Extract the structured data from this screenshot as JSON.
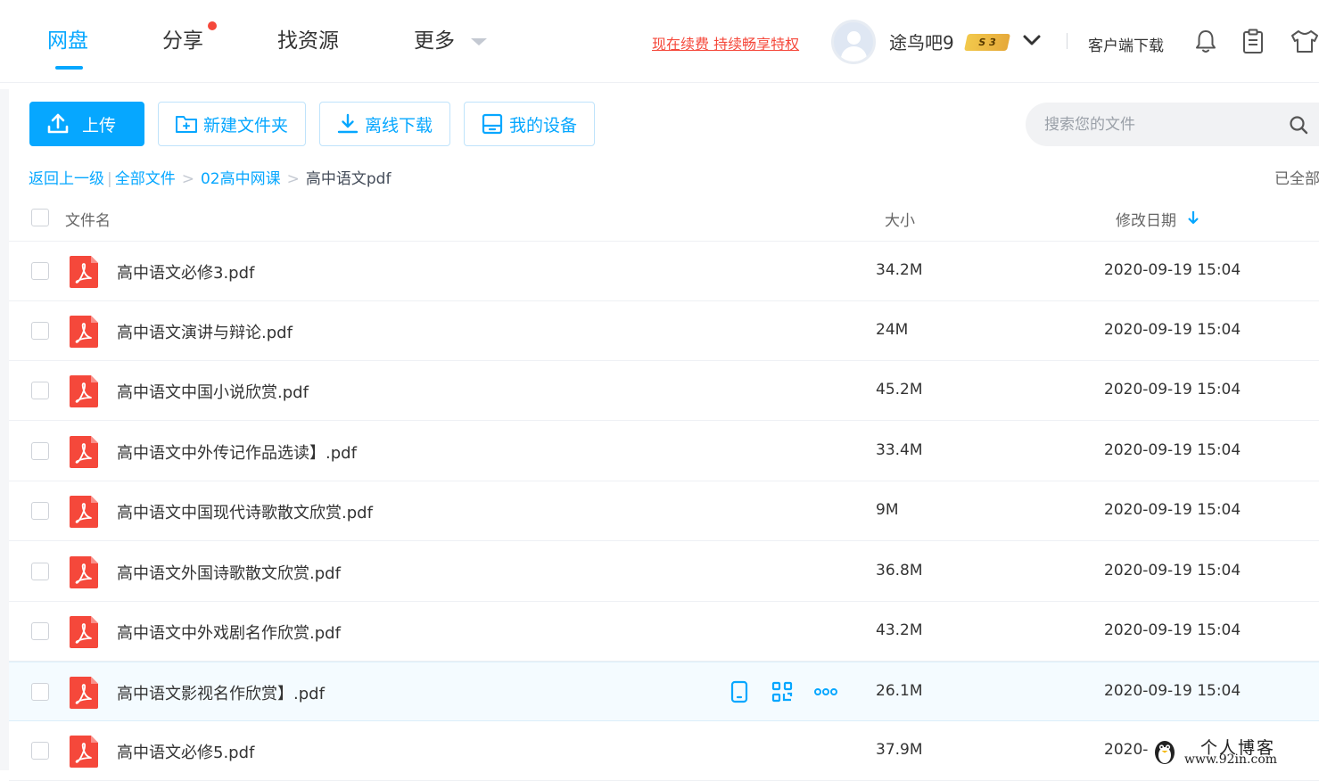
{
  "colors": {
    "accent": "#06a7ff",
    "promo": "#f5483b",
    "pdf": "#f5483b"
  },
  "nav": {
    "tabs": [
      {
        "label": "网盘",
        "active": true
      },
      {
        "label": "分享",
        "active": false
      },
      {
        "label": "找资源",
        "active": false
      },
      {
        "label": "更多",
        "active": false
      }
    ],
    "promo": "现在续费 持续畅享特权",
    "username": "途鸟吧9",
    "vip_badge": "S 3",
    "client_download": "客户端下载",
    "icons": [
      "bell-icon",
      "clipboard-icon",
      "tshirt-icon"
    ]
  },
  "toolbar": {
    "upload": "上传",
    "new_folder": "新建文件夹",
    "offline_download": "离线下载",
    "my_devices": "我的设备",
    "search_placeholder": "搜索您的文件"
  },
  "breadcrumb": {
    "back": "返回上一级",
    "items": [
      "全部文件",
      "02高中网课"
    ],
    "current": "高中语文pdf",
    "loaded_status": "已全部"
  },
  "table": {
    "headers": {
      "name": "文件名",
      "size": "大小",
      "date": "修改日期"
    },
    "rows": [
      {
        "name": "高中语文必修3.pdf",
        "size": "34.2M",
        "date": "2020-09-19 15:04"
      },
      {
        "name": "高中语文演讲与辩论.pdf",
        "size": "24M",
        "date": "2020-09-19 15:04"
      },
      {
        "name": "高中语文中国小说欣赏.pdf",
        "size": "45.2M",
        "date": "2020-09-19 15:04"
      },
      {
        "name": "高中语文中外传记作品选读】.pdf",
        "size": "33.4M",
        "date": "2020-09-19 15:04"
      },
      {
        "name": "高中语文中国现代诗歌散文欣赏.pdf",
        "size": "9M",
        "date": "2020-09-19 15:04"
      },
      {
        "name": "高中语文外国诗歌散文欣赏.pdf",
        "size": "36.8M",
        "date": "2020-09-19 15:04"
      },
      {
        "name": "高中语文中外戏剧名作欣赏.pdf",
        "size": "43.2M",
        "date": "2020-09-19 15:04"
      },
      {
        "name": "高中语文影视名作欣赏】.pdf",
        "size": "26.1M",
        "date": "2020-09-19 15:04"
      },
      {
        "name": "高中语文必修5.pdf",
        "size": "37.9M",
        "date": "2020-"
      }
    ],
    "hover_actions": [
      "phone-icon",
      "share-link-icon",
      "more-icon"
    ]
  },
  "watermark": {
    "title": "个人博客",
    "url": "www.92in.com"
  }
}
